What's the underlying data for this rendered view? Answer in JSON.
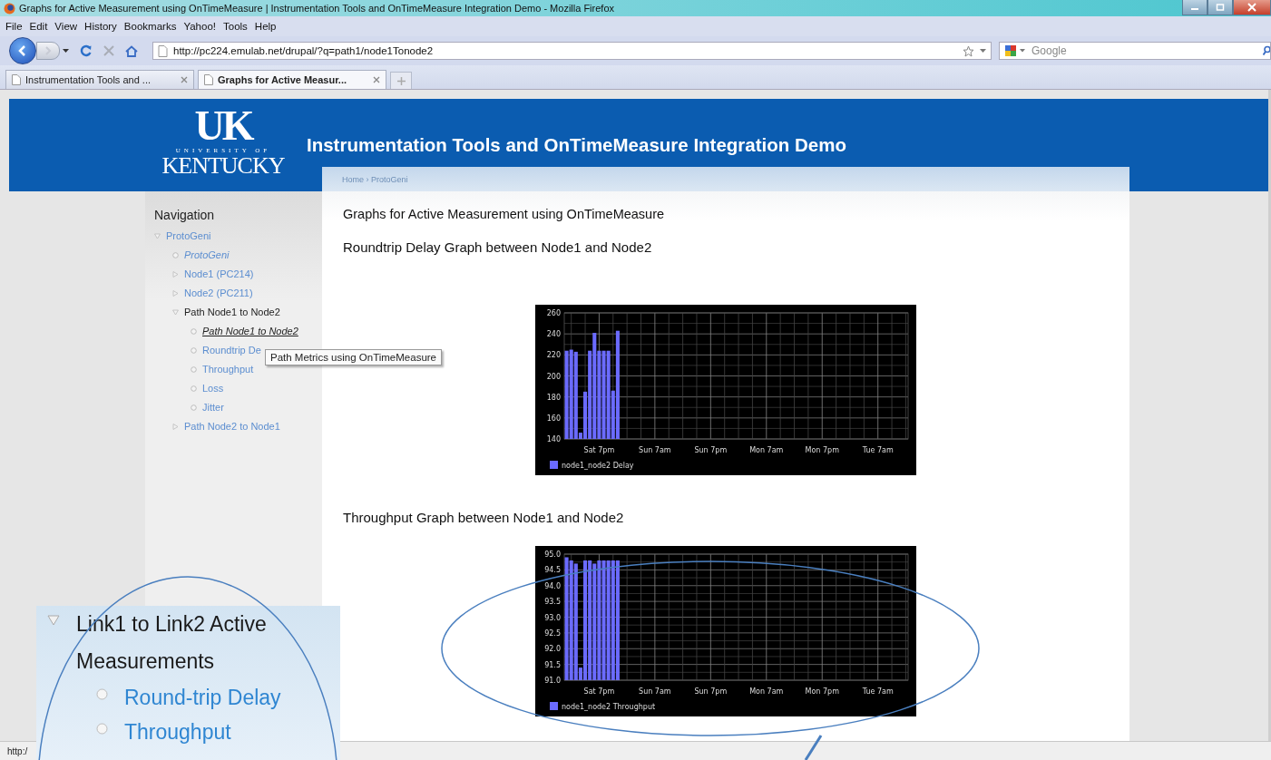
{
  "window": {
    "title": "Graphs for Active Measurement using OnTimeMeasure | Instrumentation Tools and OnTimeMeasure Integration Demo - Mozilla Firefox"
  },
  "menu": [
    "File",
    "Edit",
    "View",
    "History",
    "Bookmarks",
    "Yahoo!",
    "Tools",
    "Help"
  ],
  "address_bar": {
    "url": "http://pc224.emulab.net/drupal/?q=path1/node1Tonode2"
  },
  "search": {
    "placeholder": "Google"
  },
  "tabs": [
    {
      "label": "Instrumentation Tools and ...",
      "selected": false
    },
    {
      "label": "Graphs for Active Measur...",
      "selected": true
    }
  ],
  "site": {
    "logo_mark": "UK",
    "logo_line": "UNIVERSITY OF",
    "logo_name": "KENTUCKY",
    "title": "Instrumentation Tools and OnTimeMeasure Integration Demo"
  },
  "breadcrumb": "Home › ProtoGeni",
  "navigation": {
    "title": "Navigation",
    "items": [
      {
        "label": "ProtoGeni",
        "kind": "branch",
        "expanded": true,
        "active": false,
        "hovered": false,
        "in_trail": false,
        "children": [
          {
            "label": "ProtoGeni",
            "kind": "leaf",
            "active": true,
            "hovered": false,
            "in_trail": false
          },
          {
            "label": "Node1 (PC214)",
            "kind": "branch",
            "expanded": false,
            "active": false,
            "hovered": false,
            "in_trail": false
          },
          {
            "label": "Node2 (PC211)",
            "kind": "branch",
            "expanded": false,
            "active": false,
            "hovered": false,
            "in_trail": false
          },
          {
            "label": "Path Node1 to Node2",
            "kind": "branch",
            "expanded": true,
            "active": false,
            "hovered": false,
            "in_trail": true,
            "children": [
              {
                "label": "Path Node1 to Node2",
                "kind": "leaf",
                "active": true,
                "hovered": true,
                "in_trail": true
              },
              {
                "label": "Roundtrip De",
                "kind": "leaf",
                "active": false,
                "hovered": false,
                "in_trail": false
              },
              {
                "label": "Throughput",
                "kind": "leaf",
                "active": false,
                "hovered": false,
                "in_trail": false
              },
              {
                "label": "Loss",
                "kind": "leaf",
                "active": false,
                "hovered": false,
                "in_trail": false
              },
              {
                "label": "Jitter",
                "kind": "leaf",
                "active": false,
                "hovered": false,
                "in_trail": false
              }
            ]
          },
          {
            "label": "Path Node2 to Node1",
            "kind": "branch",
            "expanded": false,
            "active": false,
            "hovered": false,
            "in_trail": false
          }
        ]
      }
    ]
  },
  "tooltip": "Path Metrics using OnTimeMeasure",
  "page": {
    "heading": "Graphs for Active Measurement using OnTimeMeasure",
    "sections": [
      {
        "title": "Roundtrip Delay Graph between Node1 and Node2",
        "chart_data": {
          "type": "bar",
          "grid": true,
          "categories": [
            null,
            null,
            null,
            null,
            null,
            null,
            null,
            "Sat 7pm",
            null,
            null,
            null,
            null,
            null,
            null,
            null,
            null,
            null,
            null,
            null,
            "Sun 7am",
            null,
            null,
            null,
            null,
            null,
            null,
            null,
            null,
            null,
            null,
            null,
            "Sun 7pm",
            null,
            null,
            null,
            null,
            null,
            null,
            null,
            null,
            null,
            null,
            null,
            "Mon 7am",
            null,
            null,
            null,
            null,
            null,
            null,
            null,
            null,
            null,
            null,
            null,
            "Mon 7pm",
            null,
            null,
            null,
            null,
            null,
            null,
            null,
            null,
            null,
            null,
            null,
            "Tue 7am",
            null,
            null,
            null,
            null,
            null,
            null
          ],
          "ylim": [
            140,
            260
          ],
          "yticks": [
            140,
            160,
            180,
            200,
            220,
            240,
            260
          ],
          "series": [
            {
              "name": "node1_node2 Delay",
              "color": "#6b6bff",
              "values": [
                224,
                225,
                223,
                146,
                185,
                224,
                241,
                224,
                224,
                224,
                186,
                243,
                null,
                null,
                null,
                null,
                null,
                null,
                null,
                null,
                null,
                null,
                null,
                null,
                null,
                null,
                null,
                null,
                null,
                null,
                null,
                null,
                null,
                null,
                null,
                null,
                null,
                null,
                null,
                null,
                null,
                null,
                null,
                null,
                null,
                null,
                null,
                null,
                null,
                null,
                null,
                null,
                null,
                null,
                null,
                null,
                null,
                null,
                null,
                null,
                null,
                null,
                null,
                null,
                null,
                null,
                null,
                null,
                null,
                null,
                null,
                null,
                null,
                null
              ]
            }
          ]
        }
      },
      {
        "title": "Throughput Graph between Node1 and Node2",
        "chart_data": {
          "type": "bar",
          "grid": true,
          "categories": [
            null,
            null,
            null,
            null,
            null,
            null,
            null,
            "Sat 7pm",
            null,
            null,
            null,
            null,
            null,
            null,
            null,
            null,
            null,
            null,
            null,
            "Sun 7am",
            null,
            null,
            null,
            null,
            null,
            null,
            null,
            null,
            null,
            null,
            null,
            "Sun 7pm",
            null,
            null,
            null,
            null,
            null,
            null,
            null,
            null,
            null,
            null,
            null,
            "Mon 7am",
            null,
            null,
            null,
            null,
            null,
            null,
            null,
            null,
            null,
            null,
            null,
            "Mon 7pm",
            null,
            null,
            null,
            null,
            null,
            null,
            null,
            null,
            null,
            null,
            null,
            "Tue 7am",
            null,
            null,
            null,
            null,
            null,
            null
          ],
          "ylim": [
            91,
            95
          ],
          "yticks": [
            {
              "value": 91,
              "label": "91.0"
            },
            {
              "value": 91.5,
              "label": "91.5"
            },
            {
              "value": 92,
              "label": "92.0"
            },
            {
              "value": 92.5,
              "label": "92.5"
            },
            {
              "value": 93,
              "label": "93.0"
            },
            {
              "value": 93.5,
              "label": "93.5"
            },
            {
              "value": 94,
              "label": "94.0"
            },
            {
              "value": 94.5,
              "label": "94.5"
            },
            {
              "value": 95,
              "label": "95.0"
            }
          ],
          "series": [
            {
              "name": "node1_node2 Throughput",
              "color": "#6b6bff",
              "values": [
                94.9,
                94.8,
                94.7,
                91.4,
                94.8,
                94.8,
                94.7,
                94.8,
                94.8,
                94.8,
                94.8,
                94.8,
                null,
                null,
                null,
                null,
                null,
                null,
                null,
                null,
                null,
                null,
                null,
                null,
                null,
                null,
                null,
                null,
                null,
                null,
                null,
                null,
                null,
                null,
                null,
                null,
                null,
                null,
                null,
                null,
                null,
                null,
                null,
                null,
                null,
                null,
                null,
                null,
                null,
                null,
                null,
                null,
                null,
                null,
                null,
                null,
                null,
                null,
                null,
                null,
                null,
                null,
                null,
                null,
                null,
                null,
                null,
                null,
                null,
                null,
                null,
                null,
                null,
                null
              ]
            }
          ]
        }
      }
    ]
  },
  "status_bar": {
    "text": "http:/"
  },
  "callout": {
    "items": [
      {
        "label": "Link1 to Link2 Active Measurements",
        "kind": "branch",
        "expanded": true,
        "children": [
          {
            "label": "Round-trip Delay",
            "kind": "leaf"
          },
          {
            "label": "Throughput",
            "kind": "leaf"
          }
        ]
      }
    ]
  }
}
